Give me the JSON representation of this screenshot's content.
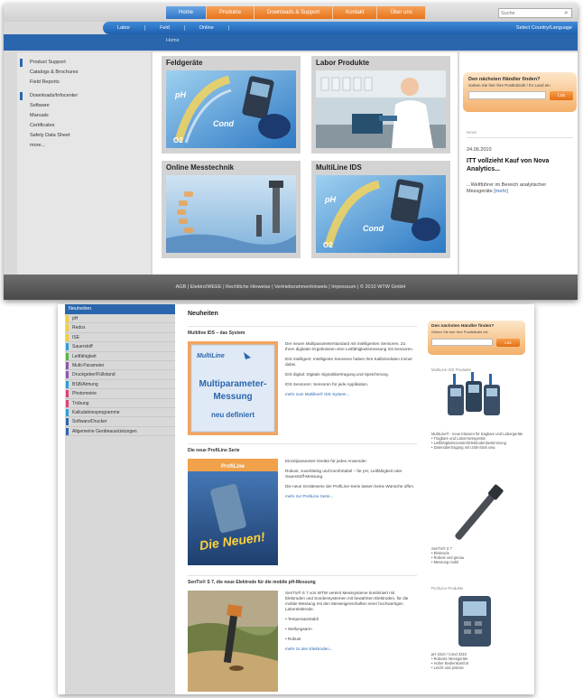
{
  "shot1": {
    "nav_tabs": [
      "Home",
      "Produkte",
      "Downloads & Support",
      "Kontakt",
      "Über uns"
    ],
    "active_tab": "Home",
    "search_placeholder": "Suche",
    "subnav": [
      "Labor",
      "Feld",
      "Online"
    ],
    "select_country": "Select Country/Language",
    "breadcrumb": "Home",
    "sidebar": [
      {
        "label": "Product Support",
        "marker": true
      },
      {
        "label": "Catalogs & Brochures",
        "marker": false
      },
      {
        "label": "Field Reports",
        "marker": false
      },
      {
        "label": "Downloads/Infocenter",
        "marker": true
      },
      {
        "label": "Software",
        "marker": false
      },
      {
        "label": "Manuals",
        "marker": false
      },
      {
        "label": "Certificates",
        "marker": false
      },
      {
        "label": "Safety Data Sheet",
        "marker": false
      },
      {
        "label": "more...",
        "marker": false
      }
    ],
    "tiles": [
      {
        "title": "Feldgeräte",
        "image": "field-meter-cond-image",
        "labels": [
          "pH",
          "Cond",
          "O2"
        ]
      },
      {
        "title": "Labor Produkte",
        "image": "laboratory-scientist-image",
        "labels": []
      },
      {
        "title": "Online Messtechnik",
        "image": "online-sensor-image",
        "labels": []
      },
      {
        "title": "MultiLine IDS",
        "image": "multiline-meter-image",
        "labels": [
          "pH",
          "Cond",
          "O2"
        ]
      }
    ],
    "dealer": {
      "heading": "Den nächsten Händler finden?",
      "sub": "Geben Sie hier Ihre Postleitzahl / Ihr Land ein",
      "button": "Los"
    },
    "news": {
      "label": "News",
      "date": "24.06.2010",
      "headline": "ITT vollzieht Kauf von Nova Analytics...",
      "text": "...Weltführer im Bereich analytischer Messgeräte",
      "more": "[mehr]"
    },
    "footer": "AGB | Elektro/WEEE | Rechtliche Hinweise | Vertriebsrahmenhinweis | Impressum | © 2010 WTW GmbH"
  },
  "shot2": {
    "sidebar_head": "Neuheiten",
    "sidebar": [
      {
        "label": "pH",
        "color": "#f2cf33"
      },
      {
        "label": "Redox",
        "color": "#f2cf33"
      },
      {
        "label": "ISE",
        "color": "#f2cf33"
      },
      {
        "label": "Sauerstoff",
        "color": "#2aa0d8"
      },
      {
        "label": "Leitfähigkeit",
        "color": "#59b441"
      },
      {
        "label": "Multi-Parameter",
        "color": "#8f57a8"
      },
      {
        "label": "Druckgeber/Füllstand",
        "color": "#8f57a8"
      },
      {
        "label": "BSB/Atmung",
        "color": "#2aa0d8"
      },
      {
        "label": "Photometrie",
        "color": "#e0407a"
      },
      {
        "label": "Trübung",
        "color": "#e0407a"
      },
      {
        "label": "Kalkulationsprogramme",
        "color": "#2aa0d8"
      },
      {
        "label": "Software/Drucker",
        "color": "#2a66ad"
      },
      {
        "label": "Allgemeine Geräteausrüstungen",
        "color": "#2a66ad"
      }
    ],
    "title": "Neuheiten",
    "sections": [
      {
        "heading": "Multiline IDS – das System",
        "banner": {
          "brand": "MultiLine",
          "line1": "Multiparameter-",
          "line2": "Messung",
          "line3": "neu definiert"
        },
        "paragraphs": [
          "Der neuen Multiparameterstandard mit intelligenten Sensoren. Zu Ihren digitalen Ergebnissen eine Leitfähigkeitsmessung mit Sensoren.",
          "IDS intelligent: Intelligente Sensoren haben Ihre Kalibrierdaten immer dabei.",
          "IDS digital: Digitale Signalübertragung und Speicherung.",
          "IDS Sensoren: Sensoren für jede Applikation."
        ],
        "more": "mehr zum Multiline® IDS System..."
      },
      {
        "heading": "Die neue ProfiLine Serie",
        "banner": {
          "line1": "Die Neuen!",
          "top": "ProfiLine"
        },
        "paragraphs": [
          "Einzelparameter-Geräte für jeden Anwender.",
          "Robust, zuverlässig und komfortabel – für pH, Leitfähigkeit oder Sauerstoff-Messung.",
          "Die neue Geräteserie der ProfiLine-Serie lassen keine Wünsche offen."
        ],
        "more": "mehr zur ProfiLine Serie..."
      },
      {
        "heading": "SenTix® S 7, die neue Elektrode für die mobile pH-Messung",
        "paragraphs": [
          "SenTix® S 7 von WTW vereint Messsysteme kombiniert mit Elektroden und Sondensystemen mit bewährten Elektroden, für die mobile Messung mit den Messeigenschaften einer hochwertigen Laborelektrode.",
          "• Temperaturstabil",
          "• Stellungsarm",
          "• Robust"
        ],
        "more": "mehr zu den Elektroden..."
      }
    ],
    "dealer": {
      "heading": "Den nächsten Händler finden?",
      "sub": "Geben Sie hier Ihre Postleitzahl ein",
      "button": "Los"
    },
    "right_blocks": [
      {
        "label": "MultiLine IDS Produkte",
        "image": "multiline-handhelds-image",
        "lines": [
          "MultiLine® - neue Klassen für tragbare und Laborgeräte",
          "• Tragbare und Labormessgeräte",
          "• Leitfähigkeitssonden/Elektrodenbestimmung",
          "• Datenübertragung mit USB-Stick usw."
        ]
      },
      {
        "label": "",
        "image": "sentix-electrode-image",
        "lines": [
          "SenTix® S 7",
          "• Elektrode",
          "• Robust und genau",
          "• Messung mobil"
        ]
      },
      {
        "label": "ProfiLine Produkte",
        "image": "profiline-meter-image",
        "lines": [
          "pH 3310 / Cond 3310",
          "• Robuste Messgeräte",
          "• Hoher Bedienkomfort",
          "• Leicht und präzise"
        ]
      }
    ]
  }
}
